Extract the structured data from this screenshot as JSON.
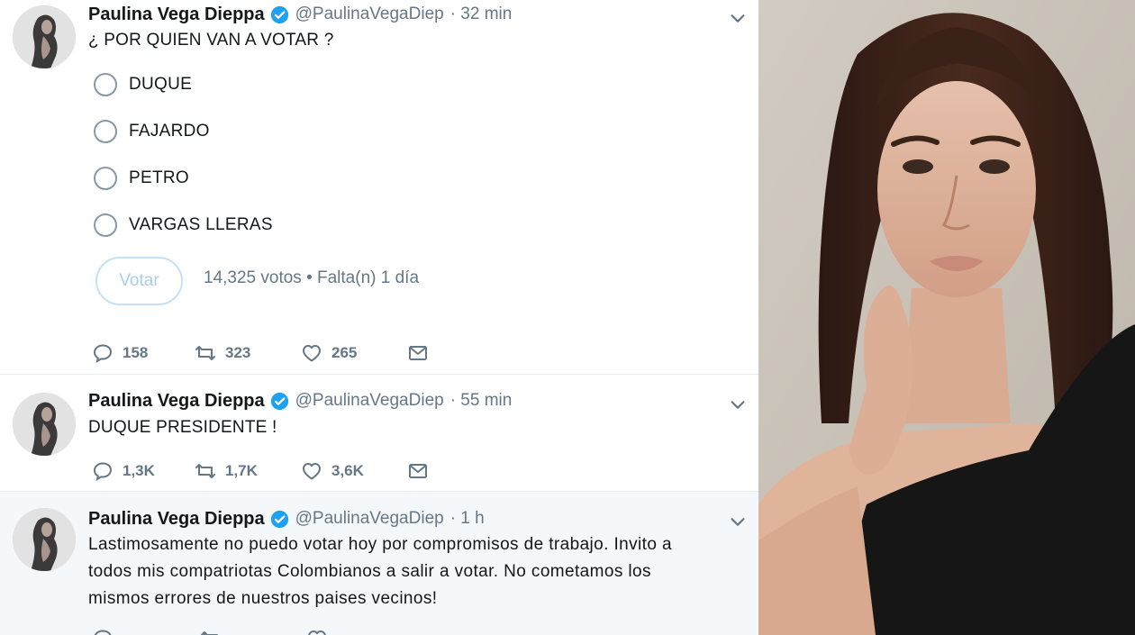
{
  "tweets": [
    {
      "name": "Paulina Vega Dieppa",
      "handle": "@PaulinaVegaDiep",
      "time": "· 32 min",
      "text": "¿ POR QUIEN VAN A VOTAR ?",
      "poll": {
        "options": [
          "DUQUE",
          "FAJARDO",
          "PETRO",
          "VARGAS LLERAS"
        ],
        "vote_label": "Votar",
        "meta": "14,325 votos • Falta(n) 1 día"
      },
      "replies": "158",
      "retweets": "323",
      "likes": "265"
    },
    {
      "name": "Paulina Vega Dieppa",
      "handle": "@PaulinaVegaDiep",
      "time": "· 55 min",
      "text": "DUQUE PRESIDENTE !",
      "replies": "1,3K",
      "retweets": "1,7K",
      "likes": "3,6K"
    },
    {
      "name": "Paulina Vega Dieppa",
      "handle": "@PaulinaVegaDiep",
      "time": "· 1 h",
      "text_lines": [
        "Lastimosamente no puedo votar hoy por compromisos de trabajo. Invito a",
        "todos mis compatriotas Colombianos a salir a votar. No cometamos los",
        "mismos errores de nuestros paises vecinos!"
      ]
    }
  ],
  "colors": {
    "text": "#14171a",
    "secondary": "#657786",
    "verified": "#1da1f2",
    "divider": "#e6ecf0",
    "photo_background": "#c9c2b8"
  },
  "icons": [
    "verified-badge-icon",
    "chevron-down-icon",
    "reply-icon",
    "retweet-icon",
    "like-icon",
    "direct-message-icon"
  ]
}
